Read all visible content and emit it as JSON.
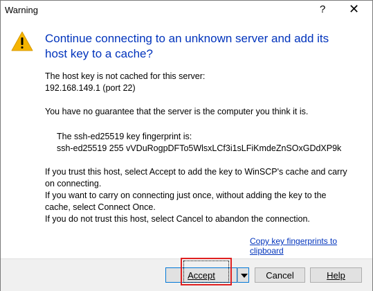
{
  "window": {
    "title": "Warning",
    "help_glyph": "?",
    "close_glyph": "X"
  },
  "message": {
    "heading": "Continue connecting to an unknown server and add its host key to a cache?",
    "line1": "The host key is not cached for this server:",
    "line2": "192.168.149.1 (port 22)",
    "line3": "You have no guarantee that the server is the computer you think it is.",
    "fp_label": "The ssh-ed25519 key fingerprint is:",
    "fp_value": "ssh-ed25519 255 vVDuRogpDFTo5WlsxLCf3i1sLFiKmdeZnSOxGDdXP9k",
    "info1": "If you trust this host, select Accept to add the key to WinSCP's cache and carry",
    "info2": "on connecting.",
    "info3": "If you want to carry on connecting just once, without adding the key to the",
    "info4": "cache, select Connect Once.",
    "info5": "If you do not trust this host, select Cancel to abandon the connection."
  },
  "link": {
    "copy": "Copy key fingerprints to clipboard"
  },
  "buttons": {
    "accept": "Accept",
    "cancel": "Cancel",
    "help": "Help"
  },
  "icons": {
    "warning": "warning-triangle-icon",
    "dropdown": "chevron-down-icon"
  },
  "colors": {
    "heading": "#0033bc",
    "highlight": "#e02020",
    "warning": "#f5b400"
  }
}
